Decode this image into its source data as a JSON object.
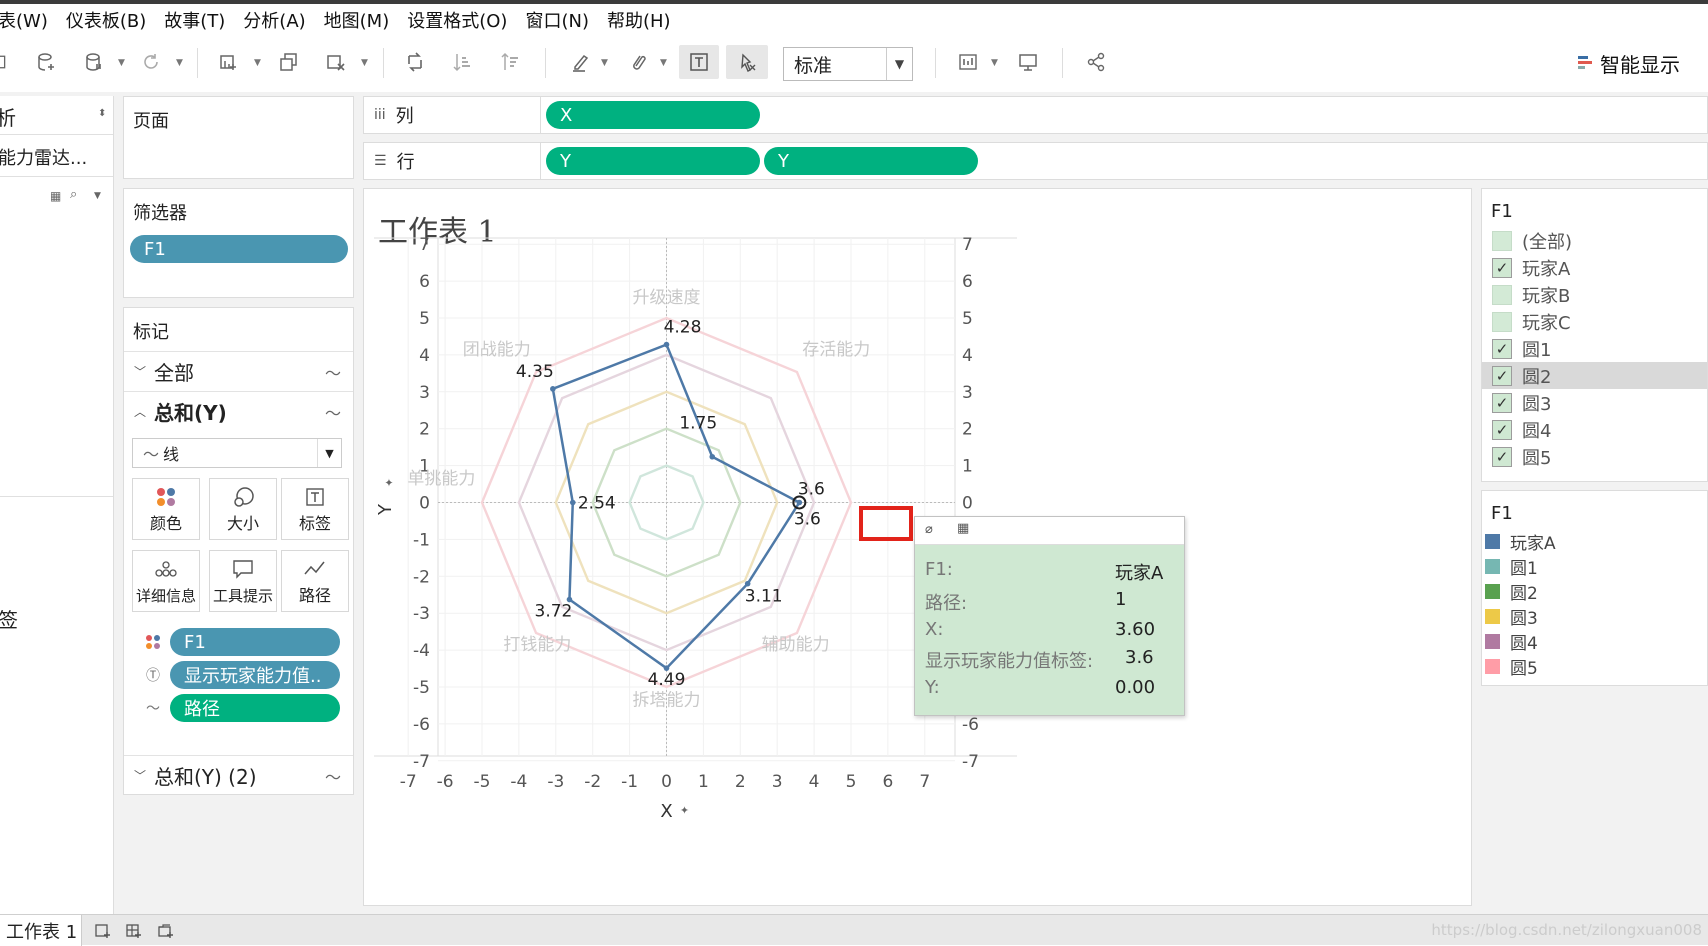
{
  "menu": [
    "表(W)",
    "仪表板(B)",
    "故事(T)",
    "分析(A)",
    "地图(M)",
    "设置格式(O)",
    "窗口(N)",
    "帮助(H)"
  ],
  "toolbar": {
    "fit": "标准",
    "show_me": "智能显示"
  },
  "data_pane": {
    "section": "析",
    "datasource": "能力雷达...",
    "label": "签"
  },
  "pages": {
    "title": "页面"
  },
  "filters": {
    "title": "筛选器",
    "pill": "F1"
  },
  "marks": {
    "title": "标记",
    "all": "全部",
    "sum_y": "总和(Y)",
    "mark_type": "线",
    "buttons": [
      "颜色",
      "大小",
      "标签",
      "详细信息",
      "工具提示",
      "路径"
    ],
    "pills": [
      "F1",
      "显示玩家能力值..",
      "路径"
    ],
    "sum_y2": "总和(Y) (2)"
  },
  "shelves": {
    "columns_label": "列",
    "rows_label": "行",
    "columns_pills": [
      "X"
    ],
    "rows_pills": [
      "Y",
      "Y"
    ]
  },
  "worksheet": {
    "title": "工作表 1"
  },
  "chart_data": {
    "type": "line",
    "xlabel": "X",
    "ylabel": "Y",
    "xlim": [
      -7,
      7
    ],
    "ylim": [
      -7,
      7
    ],
    "x_ticks": [
      -7,
      -6,
      -5,
      -4,
      -3,
      -2,
      -1,
      0,
      1,
      2,
      3,
      4,
      5,
      6,
      7
    ],
    "y_ticks": [
      7,
      6,
      5,
      4,
      3,
      2,
      1,
      0,
      -1,
      -2,
      -3,
      -4,
      -5,
      -6,
      -7
    ],
    "grid": true,
    "categories": [
      "升级速度",
      "存活能力",
      "单挑能力",
      "辅助能力",
      "拆塔能力",
      "打钱能力",
      "团战能力"
    ],
    "series": [
      {
        "name": "玩家A",
        "color": "#4e79a7",
        "points": [
          {
            "x": 3.6,
            "y": 0,
            "label": "3.6"
          },
          {
            "x": 2.2,
            "y": -2.2,
            "label": "3.11"
          },
          {
            "x": 0,
            "y": -4.49,
            "label": "4.49"
          },
          {
            "x": -2.63,
            "y": -2.63,
            "label": "3.72"
          },
          {
            "x": -2.54,
            "y": 0,
            "label": "2.54"
          },
          {
            "x": -3.08,
            "y": 3.08,
            "label": "4.35"
          },
          {
            "x": 0,
            "y": 4.28,
            "label": "4.28"
          },
          {
            "x": 1.24,
            "y": 1.24,
            "label": "1.75"
          },
          {
            "x": 3.6,
            "y": 0,
            "label": "3.6"
          }
        ]
      }
    ],
    "circles": [
      {
        "name": "圆1",
        "r": 1,
        "color": "#d0e6dc"
      },
      {
        "name": "圆2",
        "r": 2,
        "color": "#cde0c8"
      },
      {
        "name": "圆3",
        "r": 3,
        "color": "#efe2bd"
      },
      {
        "name": "圆4",
        "r": 4,
        "color": "#e5d5de"
      },
      {
        "name": "圆5",
        "r": 5,
        "color": "#f6d4d8"
      }
    ]
  },
  "tooltip": {
    "rows": [
      {
        "k": "F1:",
        "v": "玩家A"
      },
      {
        "k": "路径:",
        "v": "1"
      },
      {
        "k": "X:",
        "v": "3.60"
      },
      {
        "k": "显示玩家能力值标签:",
        "v": "3.6"
      },
      {
        "k": "Y:",
        "v": "0.00"
      }
    ]
  },
  "filter_card": {
    "title": "F1",
    "items": [
      {
        "label": "(全部)",
        "checked": false
      },
      {
        "label": "玩家A",
        "checked": true
      },
      {
        "label": "玩家B",
        "checked": false
      },
      {
        "label": "玩家C",
        "checked": false
      },
      {
        "label": "圆1",
        "checked": true
      },
      {
        "label": "圆2",
        "checked": true
      },
      {
        "label": "圆3",
        "checked": true
      },
      {
        "label": "圆4",
        "checked": true
      },
      {
        "label": "圆5",
        "checked": true
      }
    ]
  },
  "color_legend": {
    "title": "F1",
    "items": [
      {
        "label": "玩家A",
        "color": "#4e79a7"
      },
      {
        "label": "圆1",
        "color": "#76b7b2"
      },
      {
        "label": "圆2",
        "color": "#59a14f"
      },
      {
        "label": "圆3",
        "color": "#edc948"
      },
      {
        "label": "圆4",
        "color": "#b07aa1"
      },
      {
        "label": "圆5",
        "color": "#ff9da7"
      }
    ]
  },
  "status": {
    "sheet_tab": "工作表 1",
    "watermark": "https://blog.csdn.net/zilongxuan008"
  }
}
